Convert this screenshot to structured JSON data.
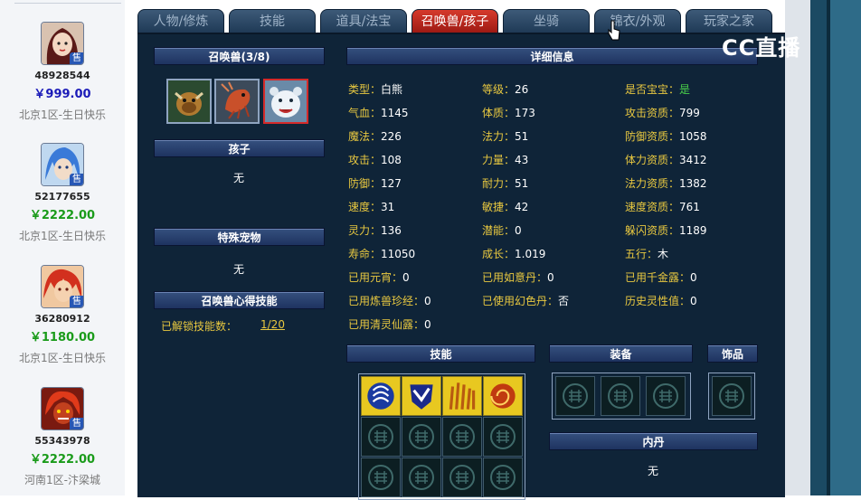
{
  "sellers": [
    {
      "id": "48928544",
      "price": "￥999.00",
      "price_color": "#1b1bb8",
      "server": "北京1区-生日快乐",
      "sale_badge": "售",
      "avatar": "female-warrior"
    },
    {
      "id": "52177655",
      "price": "￥2222.00",
      "price_color": "#1a9b1a",
      "server": "北京1区-生日快乐",
      "sale_badge": "售",
      "avatar": "blue-hair-hero"
    },
    {
      "id": "36280912",
      "price": "￥1180.00",
      "price_color": "#1a9b1a",
      "server": "北京1区-生日快乐",
      "sale_badge": "售",
      "avatar": "red-hair-hero"
    },
    {
      "id": "55343978",
      "price": "￥2222.00",
      "price_color": "#1a9b1a",
      "server": "河南1区-汴梁城",
      "sale_badge": "售",
      "avatar": "red-demon"
    }
  ],
  "tabs": [
    "人物/修炼",
    "技能",
    "道具/法宝",
    "召唤兽/孩子",
    "坐骑",
    "锦衣/外观",
    "玩家之家"
  ],
  "active_tab": 3,
  "logo_text": "CC直播",
  "pets": {
    "header": "召唤兽(3/8)",
    "slots": [
      "bull-pet",
      "shrimp-pet",
      "white-bear-pet"
    ],
    "selected": 2
  },
  "child": {
    "header": "孩子",
    "value": "无"
  },
  "special_pet": {
    "header": "特殊宠物",
    "value": "无"
  },
  "skill_insight": {
    "header": "召唤兽心得技能",
    "label": "已解锁技能数：",
    "value": "1/20"
  },
  "details": {
    "header": "详细信息",
    "col1": [
      {
        "label": "类型：",
        "value": "白熊"
      },
      {
        "label": "气血：",
        "value": "1145"
      },
      {
        "label": "魔法：",
        "value": "226"
      },
      {
        "label": "攻击：",
        "value": "108"
      },
      {
        "label": "防御：",
        "value": "127"
      },
      {
        "label": "速度：",
        "value": "31"
      },
      {
        "label": "灵力：",
        "value": "136"
      },
      {
        "label": "寿命：",
        "value": "11050"
      },
      {
        "label": "已用元宵：",
        "value": "0"
      },
      {
        "label": "已用炼兽珍经：",
        "value": "0"
      },
      {
        "label": "已用清灵仙露：",
        "value": "0"
      }
    ],
    "col2": [
      {
        "label": "等级：",
        "value": "26"
      },
      {
        "label": "体质：",
        "value": "173"
      },
      {
        "label": "法力：",
        "value": "51"
      },
      {
        "label": "力量：",
        "value": "43"
      },
      {
        "label": "耐力：",
        "value": "51"
      },
      {
        "label": "敏捷：",
        "value": "42"
      },
      {
        "label": "潜能：",
        "value": "0"
      },
      {
        "label": "成长：",
        "value": "1.019"
      },
      {
        "label": "已用如意丹：",
        "value": "0"
      },
      {
        "label": "已使用幻色丹：",
        "value": "否"
      }
    ],
    "col3": [
      {
        "label": "是否宝宝：",
        "value": "是",
        "green": true
      },
      {
        "label": "攻击资质：",
        "value": "799"
      },
      {
        "label": "防御资质：",
        "value": "1058"
      },
      {
        "label": "体力资质：",
        "value": "3412"
      },
      {
        "label": "法力资质：",
        "value": "1382"
      },
      {
        "label": "速度资质：",
        "value": "761"
      },
      {
        "label": "躲闪资质：",
        "value": "1189"
      },
      {
        "label": "五行：",
        "value": "木"
      },
      {
        "label": "已用千金露：",
        "value": "0"
      },
      {
        "label": "历史灵性值：",
        "value": "0"
      }
    ]
  },
  "skills": {
    "header": "技能",
    "icons": [
      "mind-skill-icon",
      "shield-skill-icon",
      "fire-skill-icon",
      "spiral-skill-icon"
    ]
  },
  "equipment": {
    "header": "装备"
  },
  "ornament": {
    "header": "饰品"
  },
  "inner_pill": {
    "header": "内丹",
    "value": "无"
  }
}
